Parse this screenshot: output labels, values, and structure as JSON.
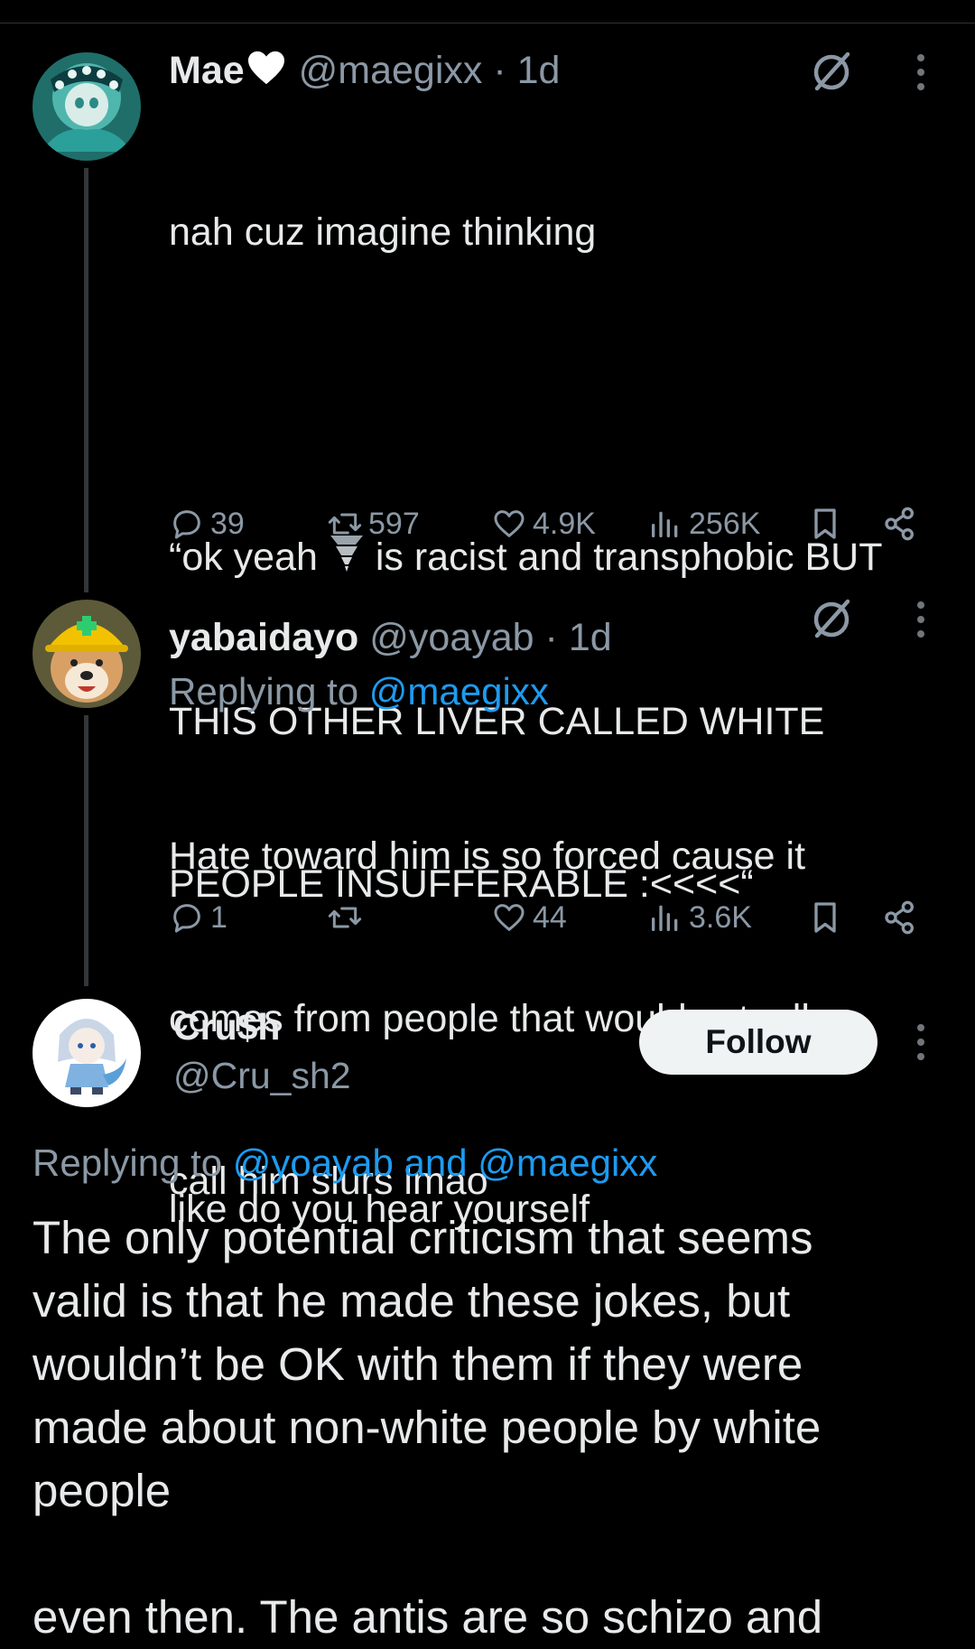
{
  "tweets": [
    {
      "name": "Mae",
      "handle": "@maegixx",
      "time": "· 1d",
      "lines": [
        "nah cuz imagine thinking",
        "",
        "“ok yeah",
        " is racist and transphobic BUT",
        "THIS OTHER LIVER CALLED WHITE",
        "PEOPLE INSUFFERABLE :<<<<“",
        "",
        "like do you hear yourself"
      ],
      "stats": {
        "replies": "39",
        "reposts": "597",
        "likes": "4.9K",
        "views": "256K"
      }
    },
    {
      "name": "yabaidayo",
      "handle": "@yoayab",
      "time": "· 1d",
      "replying_prefix": "Replying to",
      "replying_to": "@maegixx",
      "lines": [
        "Hate toward him is so forced cause it",
        "comes from people that would actually",
        "call him slurs lmao"
      ],
      "stats": {
        "replies": "1",
        "reposts": "",
        "likes": "44",
        "views": "3.6K"
      }
    },
    {
      "name": "Cru$h",
      "handle": "@Cru_sh2",
      "follow_label": "Follow",
      "replying_prefix": "Replying to",
      "replying_to": "@yoayab and @maegixx",
      "lines": [
        "The only potential criticism that seems",
        "valid is that he made these jokes, but",
        "wouldn’t be OK with them if they were",
        "made about non-white people by white",
        "people",
        "",
        "even then. The antis are so schizo and"
      ]
    }
  ],
  "icons": [
    "no-translate-icon",
    "more-icon",
    "reply-icon",
    "repost-icon",
    "like-icon",
    "views-icon",
    "bookmark-icon",
    "share-icon",
    "heart-emoji",
    "tornado-emoji"
  ],
  "colors": {
    "background": "#000000",
    "text": "#e7e9ea",
    "muted": "#8b98a5",
    "link": "#1d9bf0",
    "follow_bg": "#eff3f4"
  }
}
